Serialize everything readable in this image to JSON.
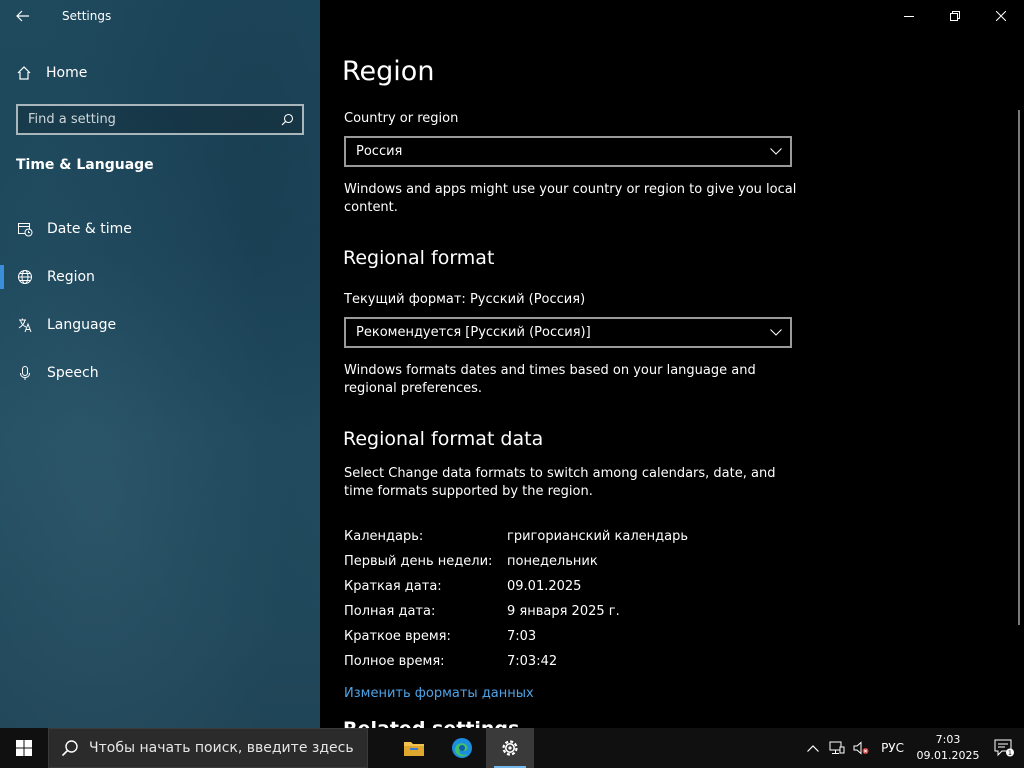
{
  "window": {
    "title": "Settings"
  },
  "sidebar": {
    "home_label": "Home",
    "search_placeholder": "Find a setting",
    "section": "Time & Language",
    "items": [
      {
        "label": "Date & time",
        "icon": "calendar-clock-icon"
      },
      {
        "label": "Region",
        "icon": "globe-icon",
        "active": true
      },
      {
        "label": "Language",
        "icon": "language-icon"
      },
      {
        "label": "Speech",
        "icon": "microphone-icon"
      }
    ]
  },
  "main": {
    "title": "Region",
    "country": {
      "label": "Country or region",
      "value": "Россия",
      "desc": "Windows and apps might use your country or region to give you local content."
    },
    "regional_format": {
      "heading": "Regional format",
      "label": "Текущий формат: Русский (Россия)",
      "value": "Рекомендуется [Русский (Россия)]",
      "desc": "Windows formats dates and times based on your language and regional preferences."
    },
    "format_data": {
      "heading": "Regional format data",
      "desc": "Select Change data formats to switch among calendars, date, and time formats supported by the region.",
      "rows": [
        {
          "key": "Календарь:",
          "value": "григорианский календарь"
        },
        {
          "key": "Первый день недели:",
          "value": "понедельник"
        },
        {
          "key": "Краткая дата:",
          "value": "09.01.2025"
        },
        {
          "key": "Полная дата:",
          "value": "9 января 2025 г."
        },
        {
          "key": "Краткое время:",
          "value": "7:03"
        },
        {
          "key": "Полное время:",
          "value": "7:03:42"
        }
      ],
      "link": "Изменить форматы данных"
    },
    "related_heading": "Related settings"
  },
  "taskbar": {
    "search_placeholder": "Чтобы начать поиск, введите здесь",
    "lang": "РУС",
    "time": "7:03",
    "date": "09.01.2025",
    "notification_count": "1"
  },
  "colors": {
    "accent": "#3a8fd8",
    "link": "#4fa3e6"
  }
}
